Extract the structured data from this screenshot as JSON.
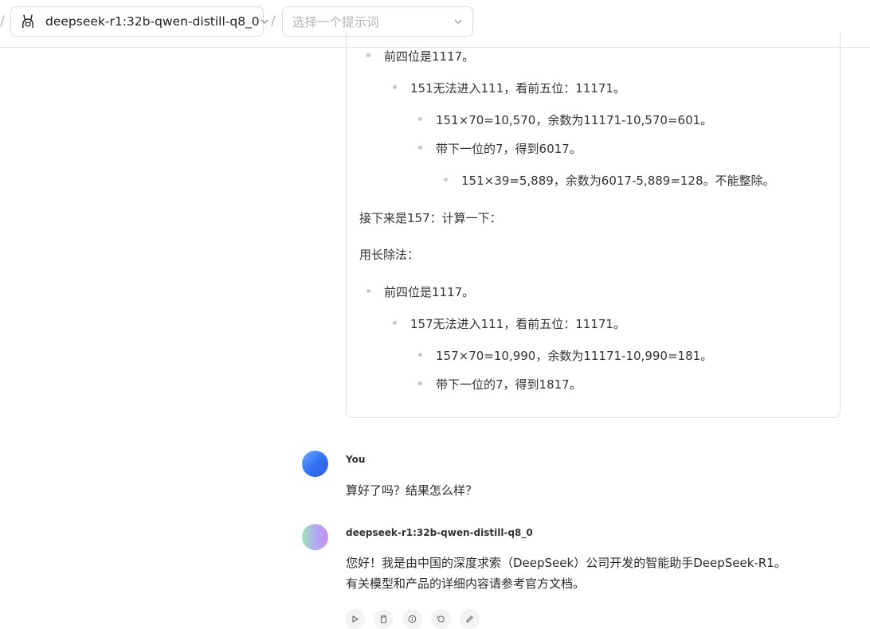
{
  "topbar": {
    "model_name": "deepseek-r1:32b-qwen-distill-q8_0",
    "prompt_placeholder": "选择一个提示词",
    "separator": "/"
  },
  "reasoning": {
    "lines": [
      "前四位是1117。",
      "151无法进入111，看前五位：11171。",
      "151×70=10,570，余数为11171-10,570=601。",
      "带下一位的7，得到6017。",
      "151×39=5,889，余数为6017-5,889=128。不能整除。",
      "接下来是157：计算一下：",
      "用长除法：",
      "前四位是1117。",
      "157无法进入111，看前五位：11171。",
      "157×70=10,990，余数为11171-10,990=181。",
      "带下一位的7，得到1817。"
    ]
  },
  "messages": [
    {
      "sender": "You",
      "text": "算好了吗？结果怎么样？"
    },
    {
      "sender": "deepseek-r1:32b-qwen-distill-q8_0",
      "text_line1": "您好！我是由中国的深度求索（DeepSeek）公司开发的智能助手DeepSeek-R1。",
      "text_line2": "有关模型和产品的详细内容请参考官方文档。"
    }
  ],
  "actions": [
    "play-icon",
    "copy-icon",
    "info-icon",
    "regenerate-icon",
    "edit-icon"
  ],
  "colors": {
    "border": "#dedede",
    "bullet": "#c8c8c8",
    "user_avatar": "#2f6ff0",
    "bot_avatar_start": "#9be3b6",
    "bot_avatar_end": "#c78cf2"
  }
}
